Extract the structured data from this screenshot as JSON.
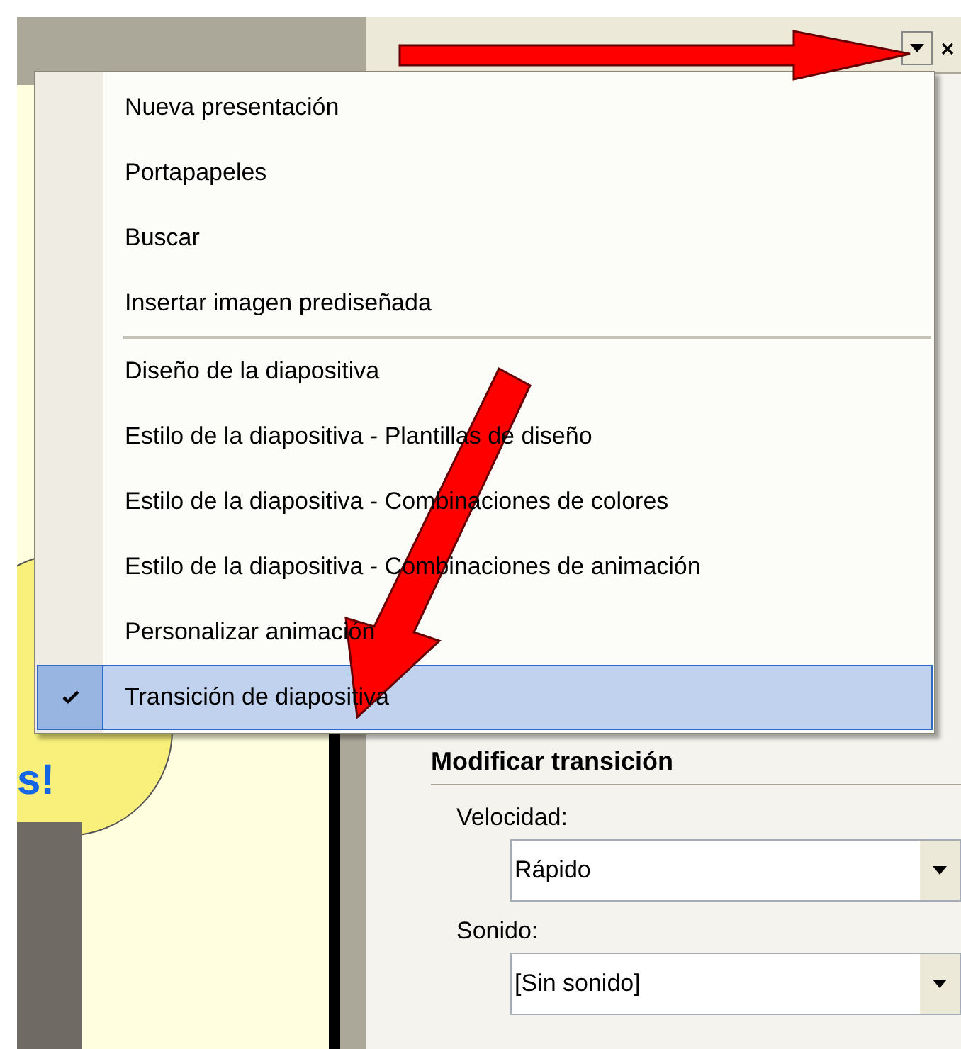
{
  "slide": {
    "texts": [
      "s!"
    ]
  },
  "menu": {
    "items": [
      {
        "label": "Nueva presentación",
        "checked": false,
        "selected": false,
        "separator_after": false
      },
      {
        "label": "Portapapeles",
        "checked": false,
        "selected": false,
        "separator_after": false
      },
      {
        "label": "Buscar",
        "checked": false,
        "selected": false,
        "separator_after": false
      },
      {
        "label": "Insertar imagen prediseñada",
        "checked": false,
        "selected": false,
        "separator_after": true
      },
      {
        "label": "Diseño de la diapositiva",
        "checked": false,
        "selected": false,
        "separator_after": false
      },
      {
        "label": "Estilo de la diapositiva - Plantillas de diseño",
        "checked": false,
        "selected": false,
        "separator_after": false
      },
      {
        "label": "Estilo de la diapositiva - Combinaciones de colores",
        "checked": false,
        "selected": false,
        "separator_after": false
      },
      {
        "label": "Estilo de la diapositiva - Combinaciones de animación",
        "checked": false,
        "selected": false,
        "separator_after": false
      },
      {
        "label": "Personalizar animación",
        "checked": false,
        "selected": false,
        "separator_after": false
      },
      {
        "label": "Transición de diapositiva",
        "checked": true,
        "selected": true,
        "separator_after": false
      }
    ]
  },
  "pane": {
    "section_title": "Modificar transición",
    "fields": [
      {
        "label": "Velocidad:",
        "value": "Rápido"
      },
      {
        "label": "Sonido:",
        "value": "[Sin sonido]"
      }
    ]
  }
}
